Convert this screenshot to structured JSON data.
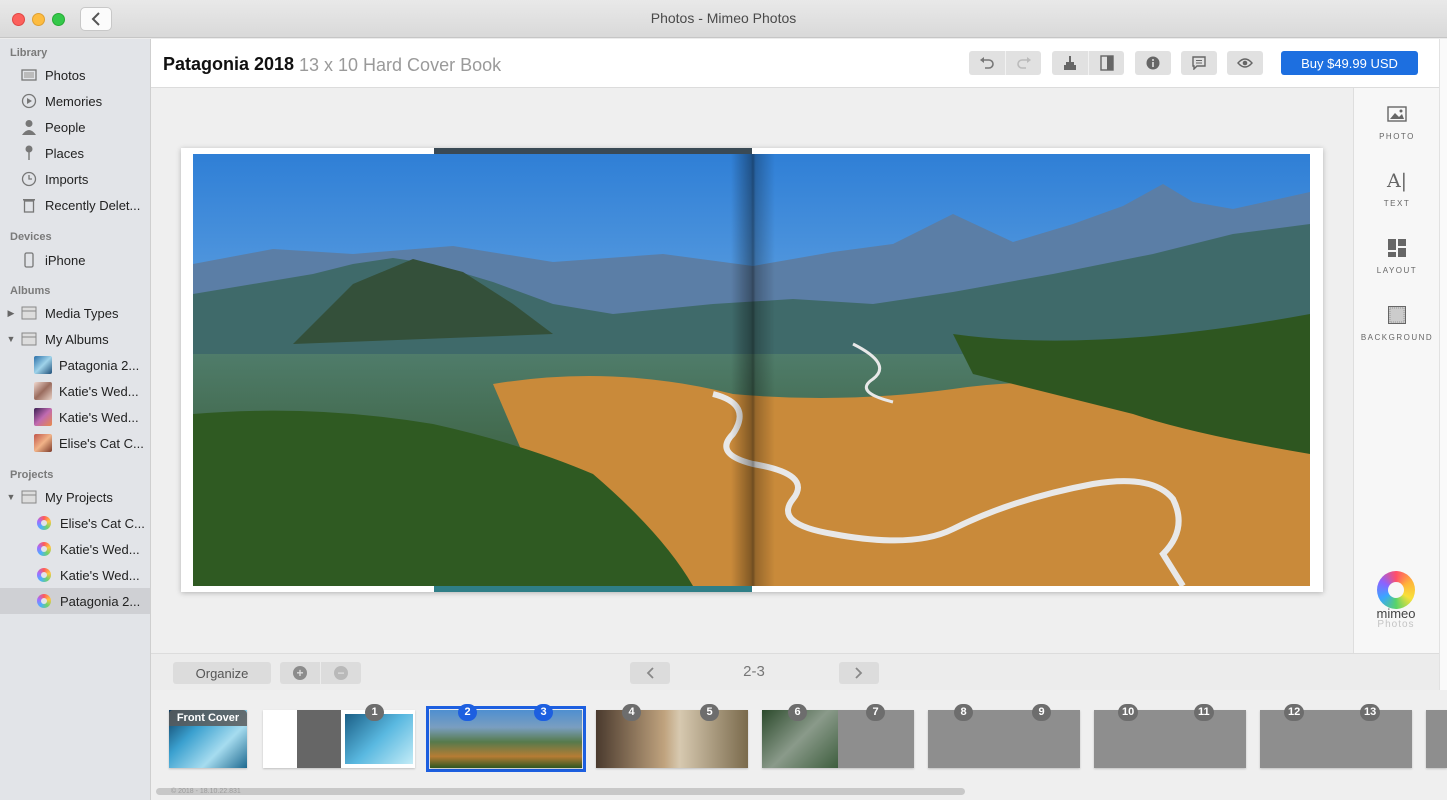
{
  "window": {
    "title": "Photos - Mimeo Photos"
  },
  "sidebar": {
    "sections": {
      "library": "Library",
      "devices": "Devices",
      "albums": "Albums",
      "projects": "Projects"
    },
    "library_items": [
      {
        "label": "Photos",
        "icon": "photos-icon"
      },
      {
        "label": "Memories",
        "icon": "memories-icon"
      },
      {
        "label": "People",
        "icon": "people-icon"
      },
      {
        "label": "Places",
        "icon": "places-icon"
      },
      {
        "label": "Imports",
        "icon": "imports-icon"
      },
      {
        "label": "Recently Delet...",
        "icon": "trash-icon"
      }
    ],
    "device_items": [
      {
        "label": "iPhone",
        "icon": "iphone-icon"
      }
    ],
    "album_items": [
      {
        "label": "Media Types",
        "icon": "folder-icon",
        "disclosure": "collapsed"
      },
      {
        "label": "My Albums",
        "icon": "folder-icon",
        "disclosure": "expanded"
      },
      {
        "label": "Patagonia 2...",
        "icon": "album-thumbnail"
      },
      {
        "label": "Katie's Wed...",
        "icon": "album-thumbnail"
      },
      {
        "label": "Katie's Wed...",
        "icon": "album-thumbnail"
      },
      {
        "label": "Elise's Cat C...",
        "icon": "album-thumbnail"
      }
    ],
    "project_items": [
      {
        "label": "My Projects",
        "icon": "folder-icon",
        "disclosure": "expanded"
      },
      {
        "label": "Elise's Cat C...",
        "icon": "mimeo-project-icon"
      },
      {
        "label": "Katie's Wed...",
        "icon": "mimeo-project-icon"
      },
      {
        "label": "Katie's Wed...",
        "icon": "mimeo-project-icon"
      },
      {
        "label": "Patagonia 2...",
        "icon": "mimeo-project-icon",
        "selected": true
      }
    ]
  },
  "header": {
    "title": "Patagonia 2018",
    "subtitle": "13 x 10 Hard Cover Book",
    "buy_label": "Buy $49.99 USD",
    "buy_color": "#1d6fe0"
  },
  "right_panel": {
    "tools": [
      {
        "label": "PHOTO",
        "icon": "photo-icon"
      },
      {
        "label": "TEXT",
        "icon": "text-icon"
      },
      {
        "label": "LAYOUT",
        "icon": "layout-icon"
      },
      {
        "label": "BACKGROUND",
        "icon": "background-icon"
      }
    ],
    "brand": "mimeo",
    "brand_sub": "Photos"
  },
  "navbar": {
    "organize_label": "Organize",
    "add_symbol": "+",
    "remove_symbol": "−",
    "page_indicator": "2-3"
  },
  "filmstrip": {
    "cover_label": "Front Cover",
    "pages": [
      "1",
      "2",
      "3",
      "4",
      "5",
      "6",
      "7",
      "8",
      "9",
      "10",
      "11",
      "12",
      "13"
    ],
    "selected_pages": [
      "2",
      "3"
    ],
    "version": "© 2018 - 18.10.22.831"
  }
}
